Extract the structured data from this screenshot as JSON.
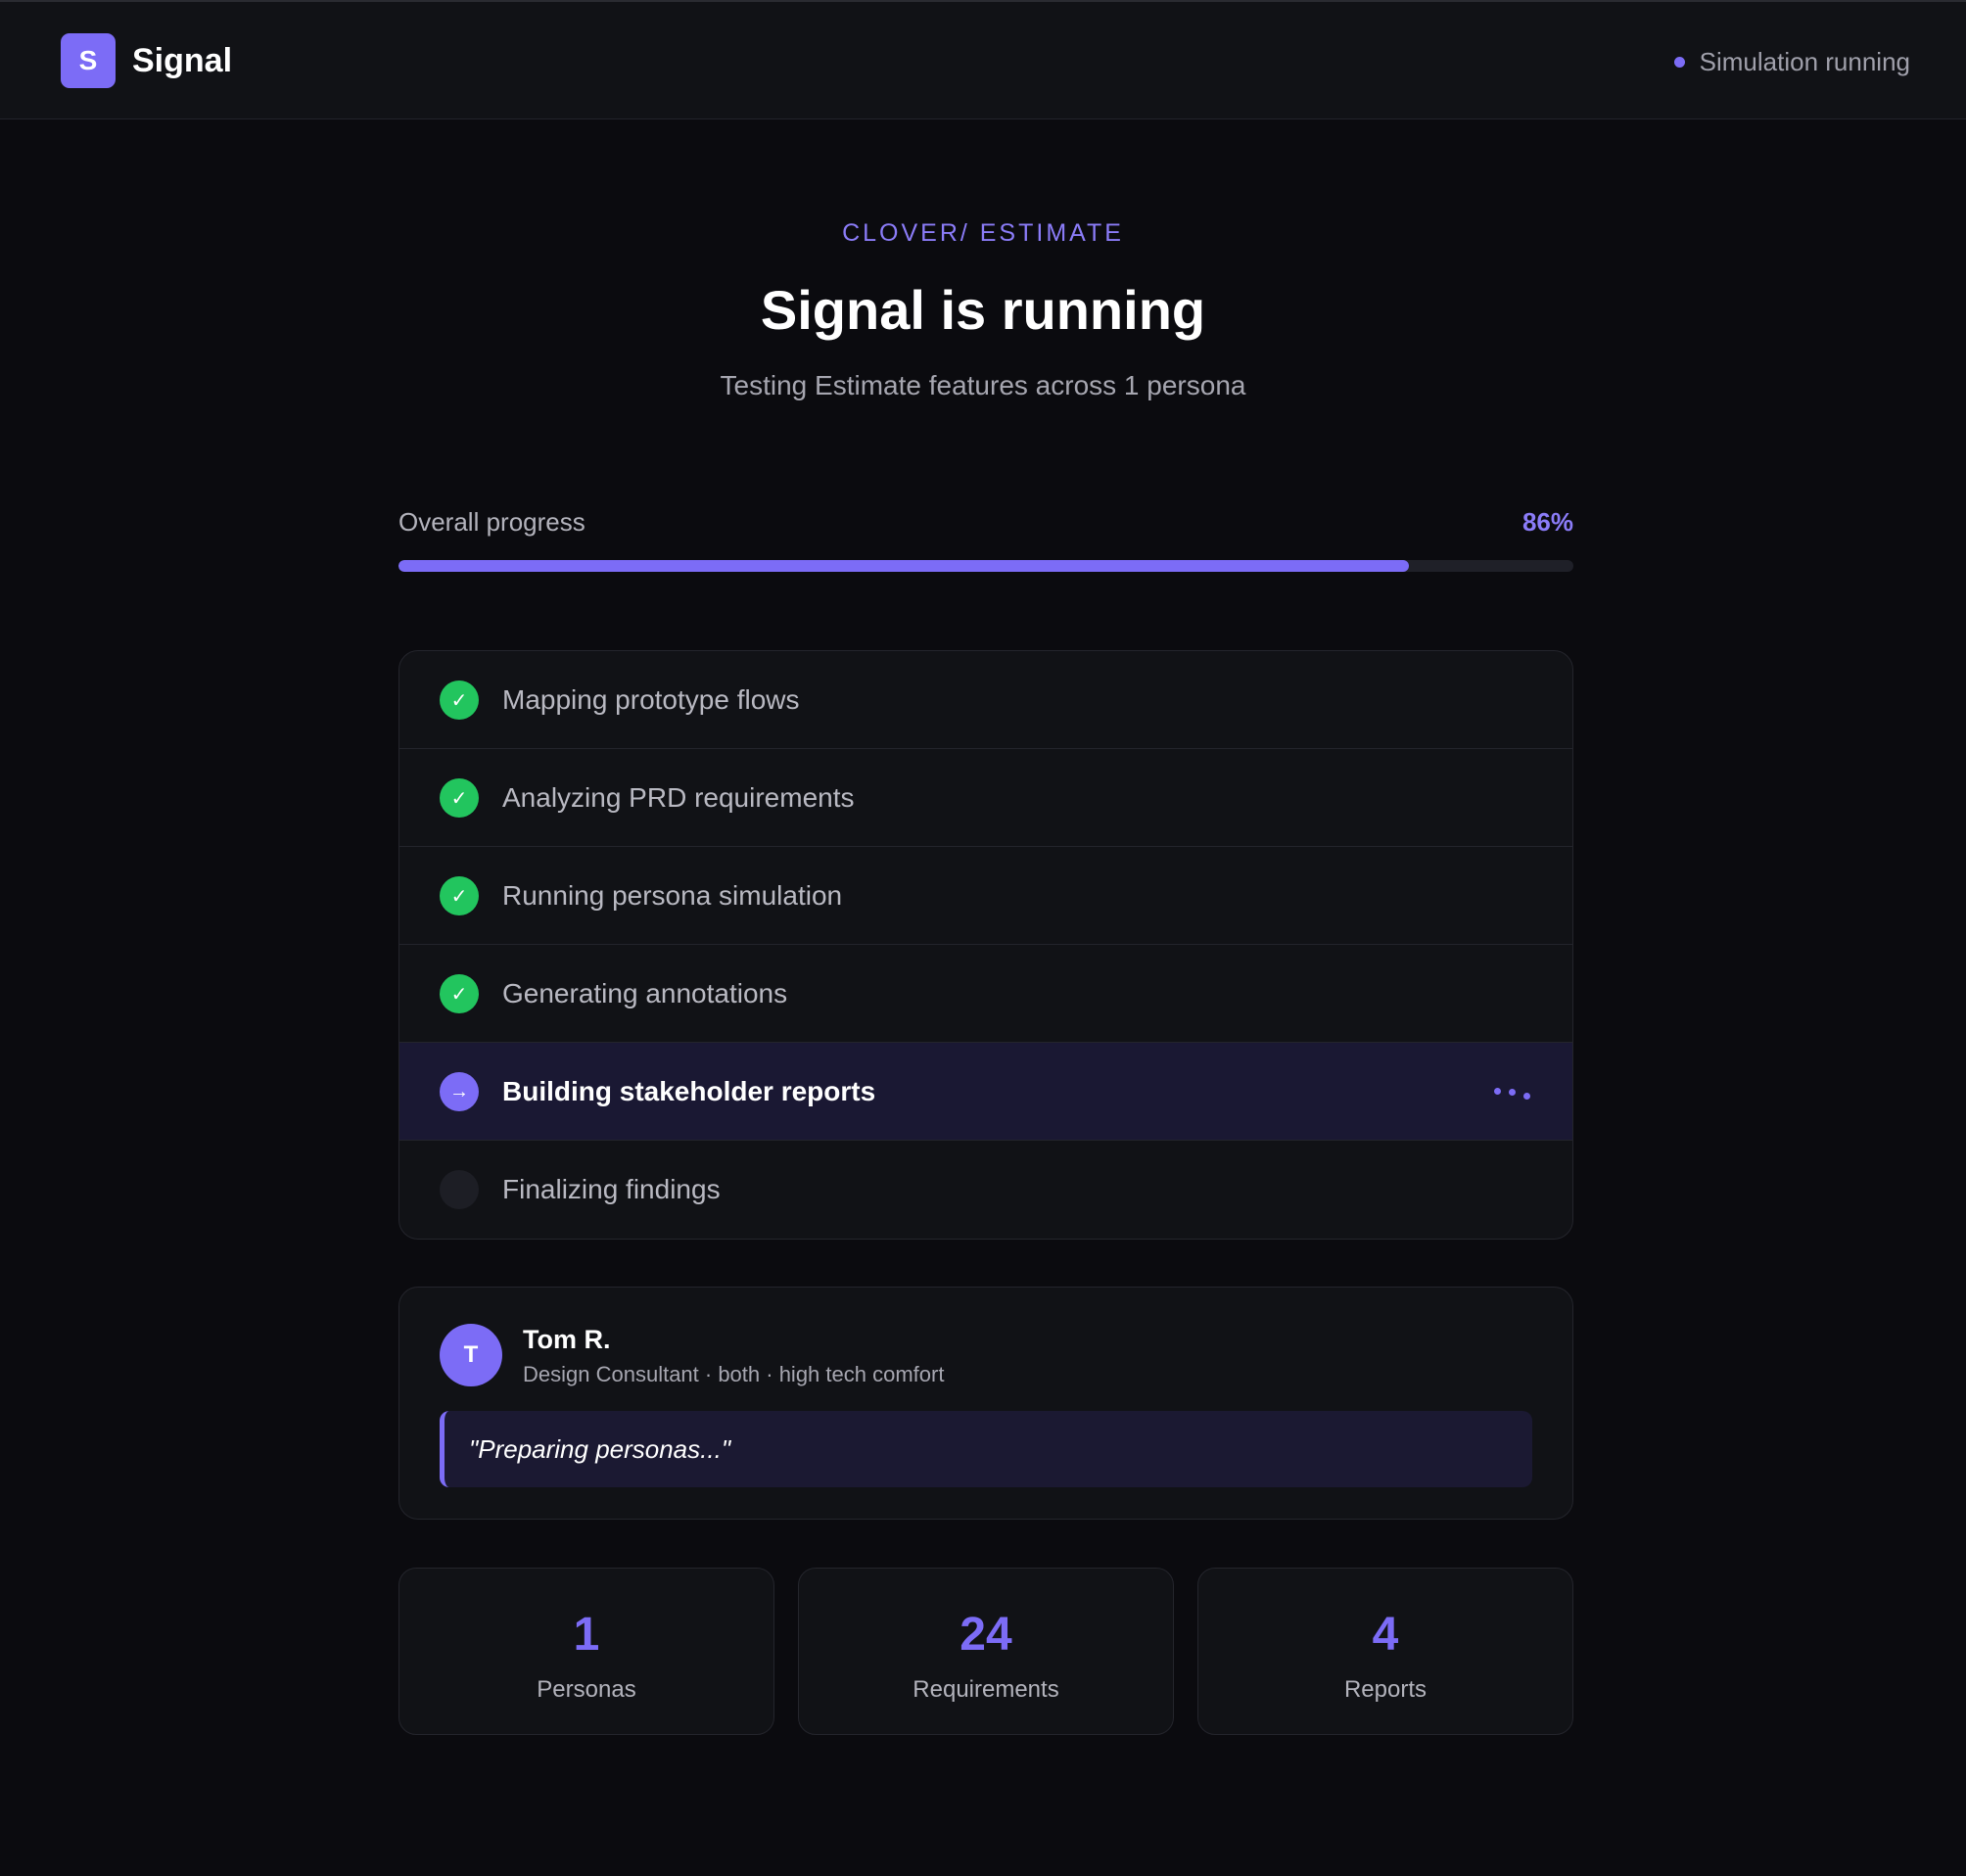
{
  "header": {
    "logo_letter": "S",
    "app_name": "Signal",
    "status_text": "Simulation running"
  },
  "hero": {
    "eyebrow": "CLOVER/ ESTIMATE",
    "title": "Signal is running",
    "subtitle": "Testing Estimate features across 1 persona"
  },
  "progress": {
    "label": "Overall progress",
    "value_text": "86%",
    "value": 0.86
  },
  "steps": [
    {
      "label": "Mapping prototype flows",
      "state": "done",
      "icon": "check-icon"
    },
    {
      "label": "Analyzing PRD requirements",
      "state": "done",
      "icon": "check-icon"
    },
    {
      "label": "Running persona simulation",
      "state": "done",
      "icon": "check-icon"
    },
    {
      "label": "Generating annotations",
      "state": "done",
      "icon": "check-icon"
    },
    {
      "label": "Building stakeholder reports",
      "state": "current",
      "icon": "arrow-right-icon"
    },
    {
      "label": "Finalizing findings",
      "state": "pending",
      "icon": "pending-circle-icon"
    }
  ],
  "persona": {
    "initial": "T",
    "name": "Tom R.",
    "meta": "Design Consultant · both · high tech comfort",
    "quote": "\"Preparing personas...\""
  },
  "stats": [
    {
      "value": "1",
      "label": "Personas"
    },
    {
      "value": "24",
      "label": "Requirements"
    },
    {
      "value": "4",
      "label": "Reports"
    }
  ],
  "colors": {
    "accent": "#7c6cf6",
    "success": "#22c55e",
    "background": "#0b0b0f",
    "surface": "#111216"
  }
}
